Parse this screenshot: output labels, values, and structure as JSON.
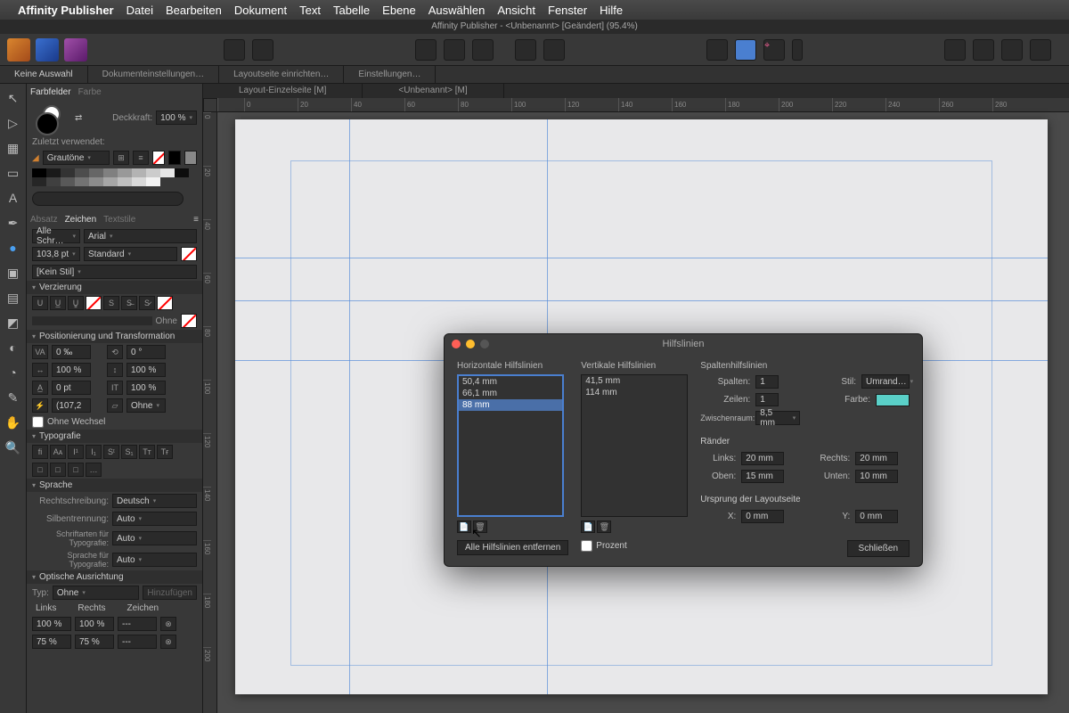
{
  "menubar": {
    "app": "Affinity Publisher",
    "items": [
      "Datei",
      "Bearbeiten",
      "Dokument",
      "Text",
      "Tabelle",
      "Ebene",
      "Auswählen",
      "Ansicht",
      "Fenster",
      "Hilfe"
    ]
  },
  "titlebar": "Affinity Publisher - <Unbenannt> [Geändert] (95.4%)",
  "contextbar": {
    "noSelection": "Keine Auswahl",
    "items": [
      "Dokumenteinstellungen…",
      "Layoutseite einrichten…",
      "Einstellungen…"
    ]
  },
  "docTabs": [
    "Layout-Einzelseite [M]",
    "<Unbenannt> [M]"
  ],
  "leftpanel": {
    "colorTabs": {
      "a": "Farbfelder",
      "b": "Farbe"
    },
    "opacityLabel": "Deckkraft:",
    "opacityVal": "100 %",
    "recent": "Zuletzt verwendet:",
    "paletteName": "Grautöne",
    "charTabs": {
      "a": "Absatz",
      "b": "Zeichen",
      "c": "Textstile"
    },
    "fontLabel": "Alle Schr…",
    "fontName": "Arial",
    "sizeVal": "103,8 pt",
    "weight": "Standard",
    "styleNone": "[Kein Stil]",
    "decor": "Verzierung",
    "ohne": "Ohne",
    "posTrans": "Positionierung und Transformation",
    "tracking": "0 ‰",
    "rotate": "0 °",
    "scaleH": "100 %",
    "scaleV": "100 %",
    "baseline": "0 pt",
    "leading": "100 %",
    "optsize": "(107,2",
    "ohne2": "Ohne",
    "noChange": "Ohne Wechsel",
    "typo": "Typografie",
    "lang": "Sprache",
    "spellLabel": "Rechtschreibung:",
    "spellVal": "Deutsch",
    "hyphLabel": "Silbentrennung:",
    "hyphVal": "Auto",
    "fontLangLabel": "Schriftarten für Typografie:",
    "fontLangVal": "Auto",
    "typeLangLabel": "Sprache für Typografie:",
    "typeLangVal": "Auto",
    "optalign": "Optische Ausrichtung",
    "typLabel": "Typ:",
    "typVal": "Ohne",
    "addBtn": "Hinzufügen",
    "colL": "Links",
    "colR": "Rechts",
    "colC": "Zeichen",
    "v100": "100 %",
    "v75": "75 %",
    "dash": "---"
  },
  "rulerH": [
    "0",
    "20",
    "40",
    "60",
    "80",
    "100",
    "120",
    "140",
    "160",
    "180",
    "200",
    "220",
    "240",
    "260",
    "280"
  ],
  "rulerV": [
    "0",
    "20",
    "40",
    "60",
    "80",
    "100",
    "120",
    "140",
    "160",
    "180",
    "200"
  ],
  "dialog": {
    "title": "Hilfslinien",
    "hLabel": "Horizontale Hilfslinien",
    "vLabel": "Vertikale Hilfslinien",
    "hList": [
      "50,4 mm",
      "66,1 mm",
      "88 mm"
    ],
    "vList": [
      "41,5 mm",
      "114 mm"
    ],
    "removeAll": "Alle Hilfslinien entfernen",
    "percent": "Prozent",
    "colGuides": "Spaltenhilfslinien",
    "colsLabel": "Spalten:",
    "colsVal": "1",
    "rowsLabel": "Zeilen:",
    "rowsVal": "1",
    "gutterLabel": "Zwischenraum:",
    "gutterVal": "8,5 mm",
    "styleLabel": "Stil:",
    "styleVal": "Umrand…",
    "colorLabel": "Farbe:",
    "margins": "Ränder",
    "leftLabel": "Links:",
    "leftVal": "20 mm",
    "rightLabel": "Rechts:",
    "rightVal": "20 mm",
    "topLabel": "Oben:",
    "topVal": "15 mm",
    "bottomLabel": "Unten:",
    "bottomVal": "10 mm",
    "origin": "Ursprung der Layoutseite",
    "xLabel": "X:",
    "xVal": "0 mm",
    "yLabel": "Y:",
    "yVal": "0 mm",
    "close": "Schließen"
  }
}
